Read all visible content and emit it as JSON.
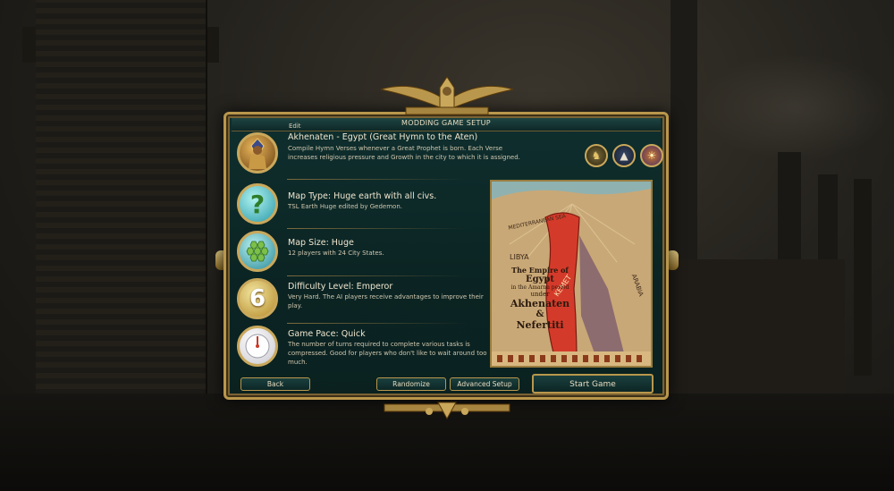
{
  "panel": {
    "title": "MODDING GAME SETUP",
    "edit_label": "Edit"
  },
  "civ": {
    "title": "Akhenaten - Egypt (Great Hymn to the Aten)",
    "desc_line1": "Compile  Hymn Verses whenever a Great Prophet is born. Each Verse",
    "desc_line2": "increases religious pressure and  Growth in the city to which it is assigned.",
    "bonus_icons": [
      "unique-unit-icon",
      "obelisk-icon",
      "faith-icon"
    ]
  },
  "map_type": {
    "title": "Map Type: Huge earth with all civs.",
    "desc": "TSL Earth Huge edited by Gedemon.",
    "icon_text": "?"
  },
  "map_size": {
    "title": "Map Size: Huge",
    "desc": "12 players with 24 City States."
  },
  "difficulty": {
    "title": "Difficulty Level: Emperor",
    "desc": "Very Hard. The AI players receive advantages to improve their play.",
    "icon_text": "6"
  },
  "pace": {
    "title": "Game Pace: Quick",
    "desc": "The number of turns required to complete various tasks is compressed. Good for players who don't like to wait around too much."
  },
  "map_image": {
    "line1": "The Empire of",
    "line2": "Egypt",
    "line3": "in the Amarna period",
    "line4": "under",
    "line5": "Akhenaten",
    "line6": "&",
    "line7": "Nefertiti",
    "label_libya": "LIBYA",
    "label_arabia": "ARABIA",
    "label_kemet": "KEMET",
    "label_sea": "MEDITERRANEAN SEA"
  },
  "buttons": {
    "back": "Back",
    "randomize": "Randomize",
    "advanced": "Advanced Setup",
    "start": "Start Game"
  },
  "colors": {
    "gold": "#c9a85c",
    "panel": "#0b2423",
    "text": "#f0e6cf"
  }
}
